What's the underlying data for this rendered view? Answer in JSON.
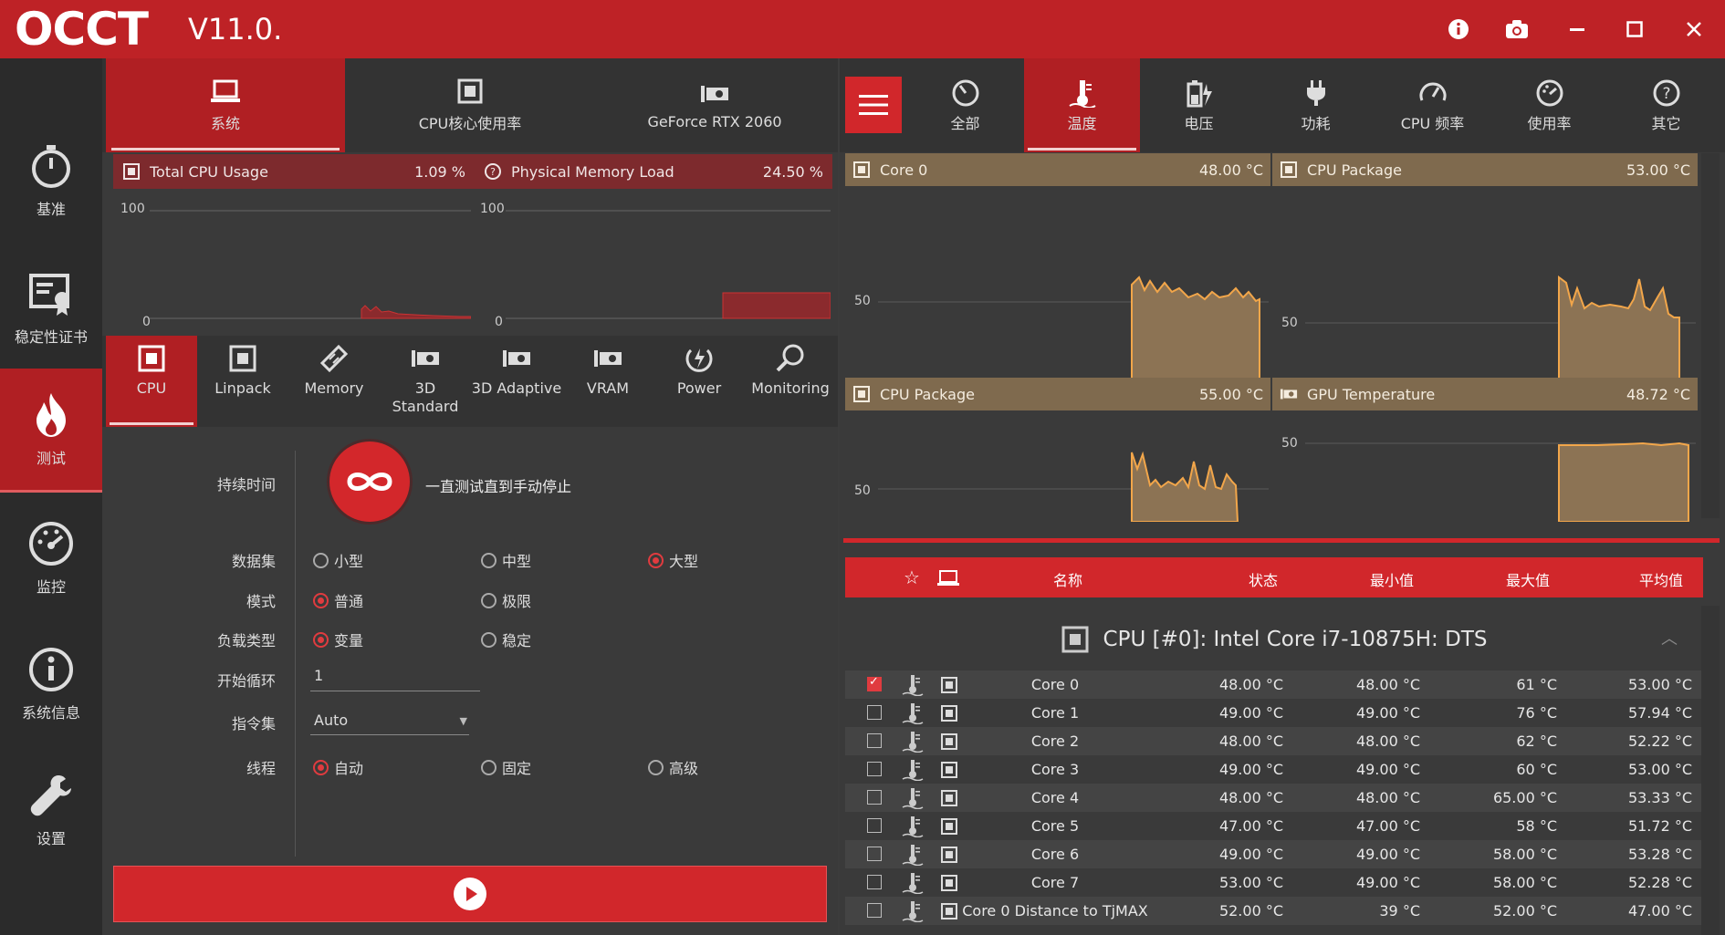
{
  "app": {
    "logo_text": "OCCT",
    "version": "V11.0.",
    "accent_color": "#be2226"
  },
  "titlebar_icons": [
    "info-icon",
    "camera-icon",
    "minimize-icon",
    "maximize-icon",
    "close-icon"
  ],
  "sidebar": {
    "items": [
      {
        "label": "基准",
        "icon": "stopwatch-icon"
      },
      {
        "label": "稳定性证书",
        "icon": "certificate-icon"
      },
      {
        "label": "测试",
        "icon": "flame-icon",
        "active": true
      },
      {
        "label": "监控",
        "icon": "gauge-icon"
      },
      {
        "label": "系统信息",
        "icon": "info-icon"
      },
      {
        "label": "设置",
        "icon": "wrench-icon"
      }
    ]
  },
  "left_tabs": [
    {
      "label": "系统",
      "active": true
    },
    {
      "label": "CPU核心使用率"
    },
    {
      "label": "GeForce RTX 2060"
    }
  ],
  "mini_charts": [
    {
      "title": "Total CPU Usage",
      "value": "1.09 %",
      "ymax": "100",
      "ymin": "0"
    },
    {
      "title": "Physical Memory Load",
      "value": "24.50 %",
      "ymax": "100",
      "ymin": "0"
    }
  ],
  "test_tabs": [
    {
      "label": "CPU",
      "active": true
    },
    {
      "label": "Linpack"
    },
    {
      "label": "Memory"
    },
    {
      "label": "3D Standard"
    },
    {
      "label": "3D Adaptive"
    },
    {
      "label": "VRAM"
    },
    {
      "label": "Power"
    },
    {
      "label": "Monitoring"
    }
  ],
  "form": {
    "duration_label": "持续时间",
    "duration_text": "一直测试直到手动停止",
    "dataset_label": "数据集",
    "dataset_options": [
      "小型",
      "中型",
      "大型"
    ],
    "dataset_selected": "大型",
    "mode_label": "模式",
    "mode_options": [
      "普通",
      "极限"
    ],
    "mode_selected": "普通",
    "load_label": "负载类型",
    "load_options": [
      "变量",
      "稳定"
    ],
    "load_selected": "变量",
    "start_cycle_label": "开始循环",
    "start_cycle_value": "1",
    "isa_label": "指令集",
    "isa_value": "Auto",
    "threads_label": "线程",
    "threads_options": [
      "自动",
      "固定",
      "高级"
    ],
    "threads_selected": "自动"
  },
  "right_tabs": [
    {
      "label": "全部"
    },
    {
      "label": "温度",
      "active": true
    },
    {
      "label": "电压"
    },
    {
      "label": "功耗"
    },
    {
      "label": "CPU 频率"
    },
    {
      "label": "使用率"
    },
    {
      "label": "其它"
    }
  ],
  "temp_charts": [
    {
      "title": "Core 0",
      "value": "48.00 °C",
      "tick_mid": "50",
      "tick_low": "0"
    },
    {
      "title": "CPU Package",
      "value": "53.00 °C",
      "tick_mid": "50",
      "tick_low": "0"
    },
    {
      "title": "CPU Package",
      "value": "55.00 °C",
      "tick_mid": "50"
    },
    {
      "title": "GPU Temperature",
      "value": "48.72 °C",
      "tick_mid": "50"
    }
  ],
  "sensor_table": {
    "headers": [
      "名称",
      "状态",
      "最小值",
      "最大值",
      "平均值"
    ],
    "group_title": "CPU [#0]: Intel Core i7-10875H: DTS",
    "rows": [
      {
        "name": "Core 0",
        "status": "48.00 °C",
        "min": "48.00 °C",
        "max": "61 °C",
        "avg": "53.00 °C",
        "checked": true
      },
      {
        "name": "Core 1",
        "status": "49.00 °C",
        "min": "49.00 °C",
        "max": "76 °C",
        "avg": "57.94 °C"
      },
      {
        "name": "Core 2",
        "status": "48.00 °C",
        "min": "48.00 °C",
        "max": "62 °C",
        "avg": "52.22 °C"
      },
      {
        "name": "Core 3",
        "status": "49.00 °C",
        "min": "49.00 °C",
        "max": "60 °C",
        "avg": "53.00 °C"
      },
      {
        "name": "Core 4",
        "status": "48.00 °C",
        "min": "48.00 °C",
        "max": "65.00 °C",
        "avg": "53.33 °C"
      },
      {
        "name": "Core 5",
        "status": "47.00 °C",
        "min": "47.00 °C",
        "max": "58 °C",
        "avg": "51.72 °C"
      },
      {
        "name": "Core 6",
        "status": "49.00 °C",
        "min": "49.00 °C",
        "max": "58.00 °C",
        "avg": "53.28 °C"
      },
      {
        "name": "Core 7",
        "status": "53.00 °C",
        "min": "49.00 °C",
        "max": "58.00 °C",
        "avg": "52.28 °C"
      },
      {
        "name": "Core 0 Distance to TjMAX",
        "status": "52.00 °C",
        "min": "39 °C",
        "max": "52.00 °C",
        "avg": "47.00 °C"
      }
    ]
  }
}
